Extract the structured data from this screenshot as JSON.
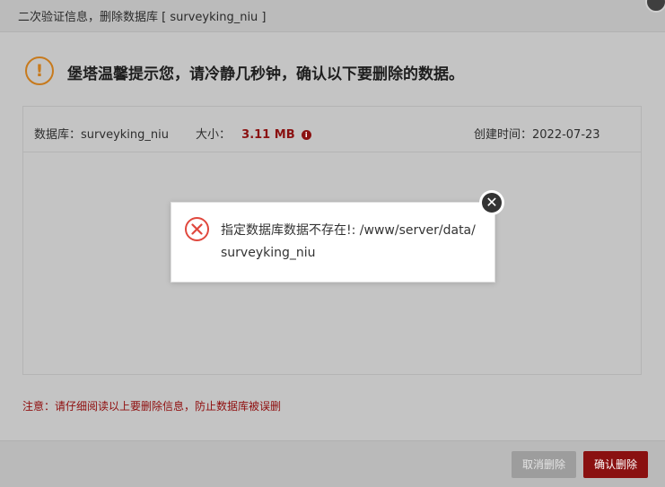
{
  "dialog": {
    "title": "二次验证信息，删除数据库 [ surveyking_niu ]",
    "warning_text": "堡塔温馨提示您，请冷静几秒钟，确认以下要删除的数据。",
    "warning_icon": "!",
    "info": {
      "db_label": "数据库：",
      "db_name": "surveyking_niu",
      "size_label": "大小：",
      "size_value": "3.11 MB",
      "created_label": "创建时间：",
      "created_value": "2022-07-23"
    },
    "notice": "注意：请仔细阅读以上要删除信息，防止数据库被误删",
    "buttons": {
      "cancel": "取消删除",
      "confirm": "确认删除"
    }
  },
  "toast": {
    "message": "指定数据库数据不存在!: /www/server/data/surveyking_niu",
    "close_glyph": "✕"
  },
  "colors": {
    "danger": "#8a1111",
    "warning": "#c77a1d",
    "error_icon": "#e0483e"
  }
}
